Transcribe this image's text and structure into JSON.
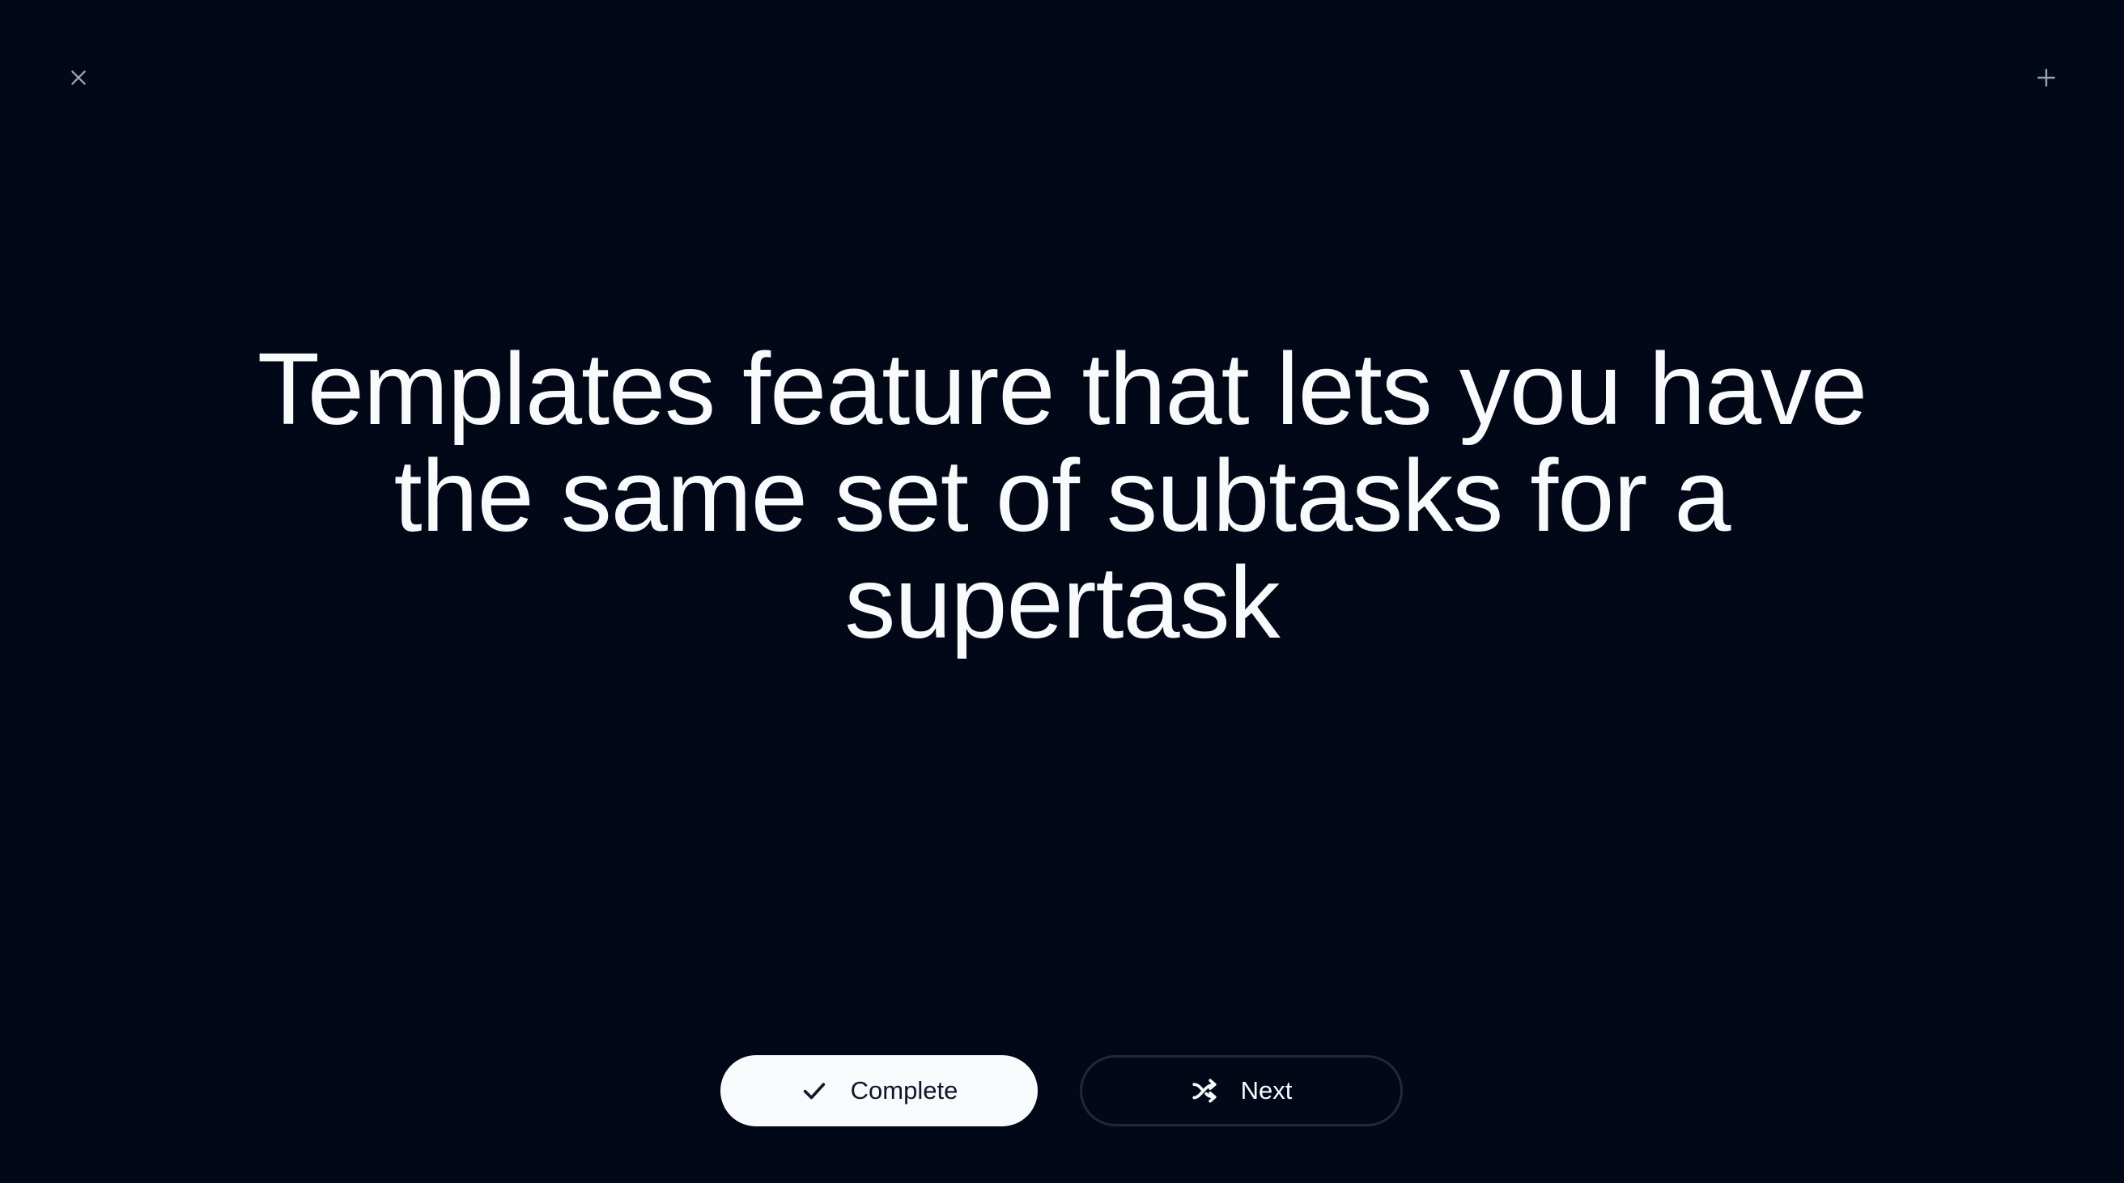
{
  "header": {
    "close_icon": "close-icon",
    "add_icon": "plus-icon"
  },
  "main": {
    "headline": "Templates feature that lets you have the same set of subtasks for a supertask"
  },
  "actions": {
    "complete_label": "Complete",
    "complete_icon": "check-icon",
    "next_label": "Next",
    "next_icon": "shuffle-icon"
  },
  "colors": {
    "background": "#020817",
    "text": "#f8fafc",
    "primary_button_bg": "#f8fafc",
    "primary_button_text": "#0f172a",
    "outline_border": "#1e293b",
    "icon_muted": "#94a3b8"
  }
}
